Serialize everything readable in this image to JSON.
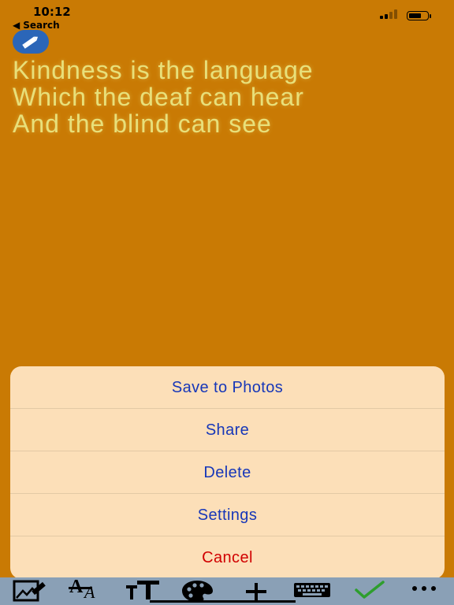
{
  "status_bar": {
    "time": "10:12",
    "back_label": "Search",
    "back_arrow": "◀"
  },
  "quote": {
    "lines": [
      "Kindness is the language",
      "Which the deaf can hear",
      "And the blind can see"
    ],
    "color": "#e8e07a",
    "background": "#c97a04"
  },
  "action_sheet": {
    "items": [
      {
        "label": "Save to Photos"
      },
      {
        "label": "Share"
      },
      {
        "label": "Delete"
      },
      {
        "label": "Settings"
      }
    ],
    "cancel_label": "Cancel",
    "accent": "#1737b8",
    "destructive_color": "#d10000",
    "background": "#fcdfb8"
  },
  "toolbar": {
    "icons": [
      "edit-image-icon",
      "font-style-icon",
      "text-size-icon",
      "palette-icon",
      "plus-icon",
      "keyboard-icon",
      "checkmark-icon",
      "more-icon"
    ],
    "checkmark_color": "#2e9e2e"
  }
}
